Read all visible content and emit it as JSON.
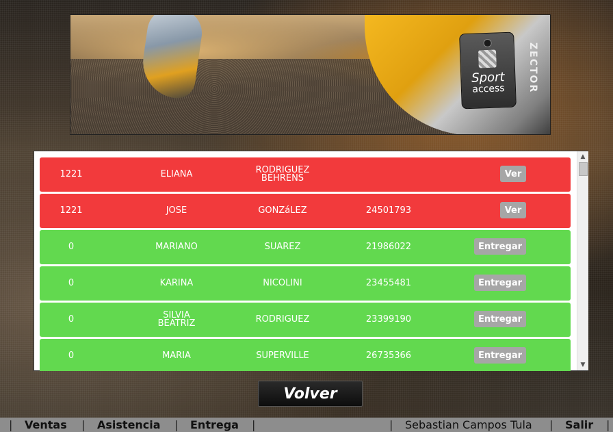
{
  "banner": {
    "tag_line1": "Sport",
    "tag_line2": "access",
    "brand": "ZECTOR"
  },
  "rows": [
    {
      "status": "red",
      "col1": "1221",
      "col2": "ELIANA",
      "col3": "RODRIGUEZ BEHRENS",
      "col4": "",
      "action": "Ver"
    },
    {
      "status": "red",
      "col1": "1221",
      "col2": "JOSE",
      "col3": "GONZáLEZ",
      "col4": "24501793",
      "action": "Ver"
    },
    {
      "status": "green",
      "col1": "0",
      "col2": "MARIANO",
      "col3": "SUAREZ",
      "col4": "21986022",
      "action": "Entregar"
    },
    {
      "status": "green",
      "col1": "0",
      "col2": "KARINA",
      "col3": "NICOLINI",
      "col4": "23455481",
      "action": "Entregar"
    },
    {
      "status": "green",
      "col1": "0",
      "col2": "SILVIA BEATRIZ",
      "col3": "RODRIGUEZ",
      "col4": "23399190",
      "action": "Entregar"
    },
    {
      "status": "green",
      "col1": "0",
      "col2": "MARIA",
      "col3": "SUPERVILLE",
      "col4": "26735366",
      "action": "Entregar"
    }
  ],
  "volver_label": "Volver",
  "footer": {
    "ventas": "Ventas",
    "asistencia": "Asistencia",
    "entrega": "Entrega",
    "user": "Sebastian Campos Tula",
    "salir": "Salir",
    "separator": "|"
  },
  "colors": {
    "red_row": "#f23a3c",
    "green_row": "#62d94f",
    "button": "#a6a6a6"
  }
}
